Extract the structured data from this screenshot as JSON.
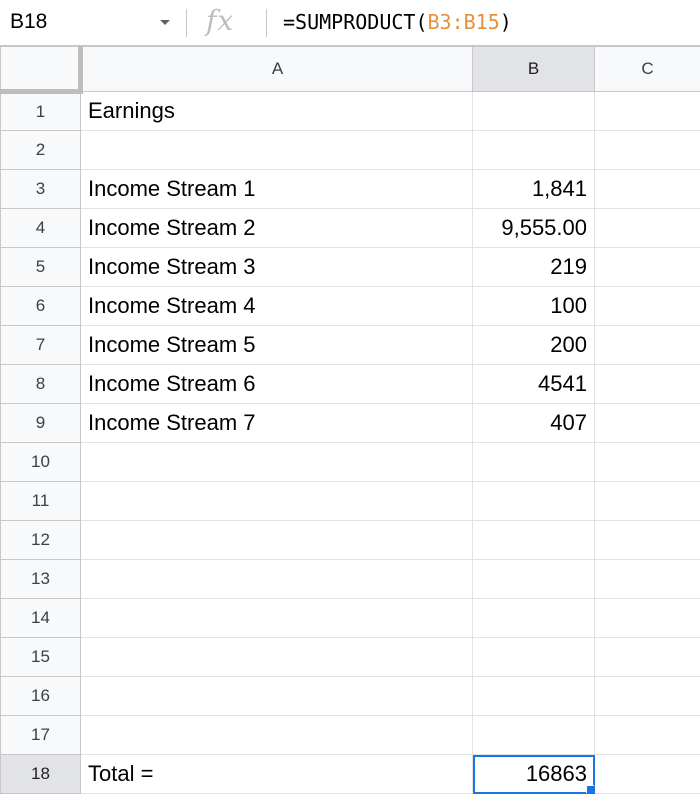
{
  "formula_bar": {
    "name_box": "B18",
    "fx_label": "fx",
    "formula_prefix": "=SUMPRODUCT(",
    "formula_ref": "B3:B15",
    "formula_suffix": ")",
    "ref_color": "#e69138"
  },
  "sheet": {
    "column_headers": [
      "A",
      "B",
      "C"
    ],
    "active_column": "B",
    "active_row": "18",
    "selected_cell": "B18",
    "selection_color": "#1a73e8",
    "rows": [
      {
        "num": "1",
        "a": "Earnings",
        "b": "",
        "c": ""
      },
      {
        "num": "2",
        "a": "",
        "b": "",
        "c": ""
      },
      {
        "num": "3",
        "a": "Income Stream 1",
        "b": "1,841",
        "c": ""
      },
      {
        "num": "4",
        "a": "Income Stream 2",
        "b": "9,555.00",
        "c": ""
      },
      {
        "num": "5",
        "a": "Income Stream 3",
        "b": "219",
        "c": ""
      },
      {
        "num": "6",
        "a": "Income Stream 4",
        "b": "100",
        "c": ""
      },
      {
        "num": "7",
        "a": "Income Stream 5",
        "b": "200",
        "c": ""
      },
      {
        "num": "8",
        "a": "Income Stream 6",
        "b": "4541",
        "c": ""
      },
      {
        "num": "9",
        "a": "Income Stream 7",
        "b": "407",
        "c": ""
      },
      {
        "num": "10",
        "a": "",
        "b": "",
        "c": ""
      },
      {
        "num": "11",
        "a": "",
        "b": "",
        "c": ""
      },
      {
        "num": "12",
        "a": "",
        "b": "",
        "c": ""
      },
      {
        "num": "13",
        "a": "",
        "b": "",
        "c": ""
      },
      {
        "num": "14",
        "a": "",
        "b": "",
        "c": ""
      },
      {
        "num": "15",
        "a": "",
        "b": "",
        "c": ""
      },
      {
        "num": "16",
        "a": "",
        "b": "",
        "c": ""
      },
      {
        "num": "17",
        "a": "",
        "b": "",
        "c": ""
      },
      {
        "num": "18",
        "a": "Total =",
        "b": "16863",
        "c": ""
      }
    ]
  }
}
